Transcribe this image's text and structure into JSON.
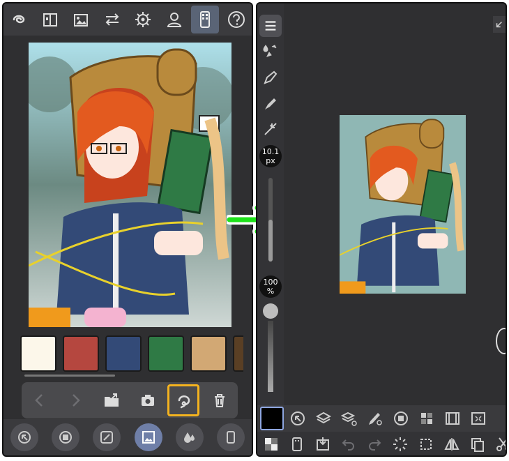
{
  "left_screen": {
    "top_icons": [
      "clip-logo-icon",
      "book-icon",
      "gallery-icon",
      "swap-icon",
      "gear-icon",
      "user-icon",
      "smartphone-icon",
      "help-icon"
    ],
    "active_top_icon": "smartphone-icon",
    "palette_colors": [
      "#fcf7ea",
      "#b5473f",
      "#334a77",
      "#2f7a45",
      "#d2a874",
      "#5a3f24"
    ],
    "toolbar_icons": [
      "back-icon",
      "forward-icon",
      "folder-export-icon",
      "camera-icon",
      "lasso-icon",
      "trash-icon"
    ],
    "highlight_color": "#f4b31f",
    "bottom_icons": [
      "navigator-icon",
      "layer-icon",
      "edit-icon",
      "image-icon",
      "drops-icon",
      "more-icon"
    ]
  },
  "arrow_color": "#1ee31a",
  "right_screen": {
    "brush_size": {
      "value": "10.1",
      "unit": "px"
    },
    "opacity": {
      "value": "100",
      "unit": "%"
    },
    "row1_icons": [
      "color-swatch",
      "navigator-icon",
      "layers-icon",
      "layer-property-icon",
      "brush-settings-icon",
      "circle-icon",
      "color-set-icon",
      "animation-icon",
      "fit-icon"
    ],
    "row2_icons": [
      "transparent-icon",
      "smartphone-icon",
      "import-icon",
      "undo-icon",
      "redo-icon",
      "loading-icon",
      "crop-icon",
      "flip-icon",
      "copy-icon",
      "cut-icon"
    ]
  }
}
